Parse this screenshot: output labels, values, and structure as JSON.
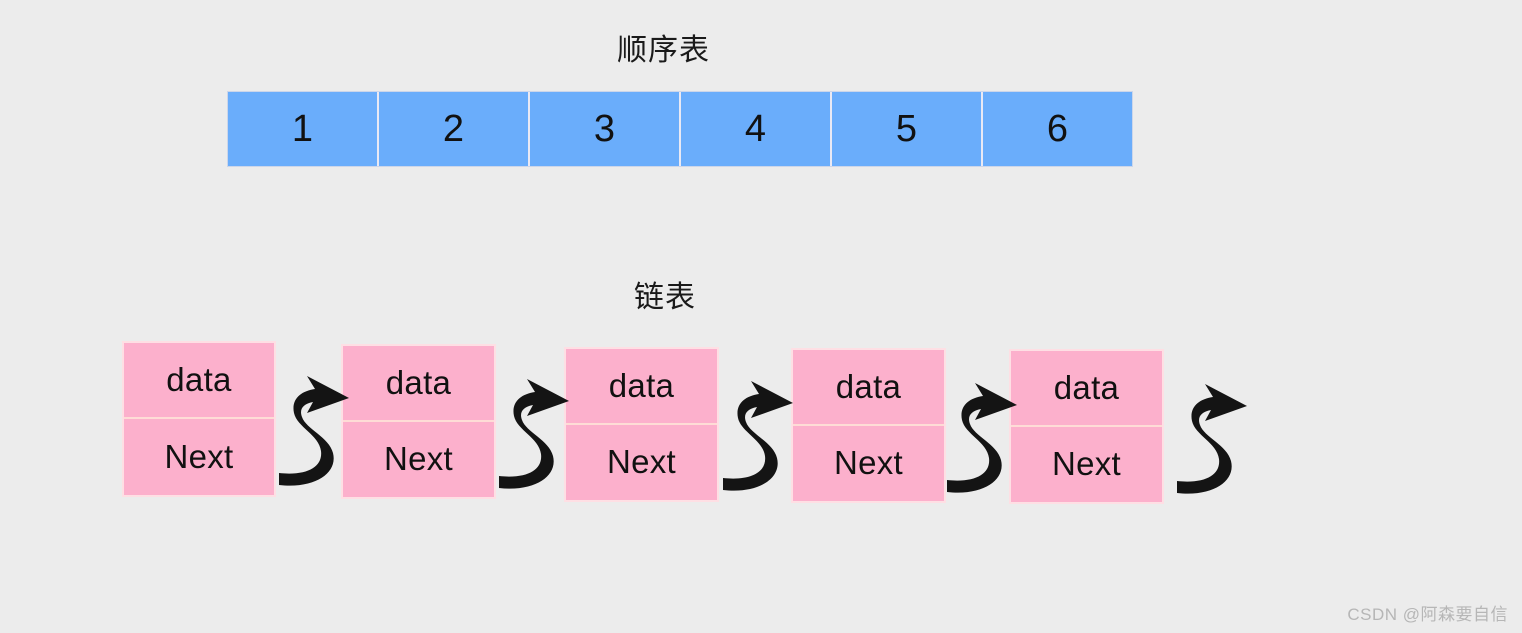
{
  "background_color": "#ececec",
  "sections": {
    "array": {
      "title": "顺序表",
      "cell_color": "#6aadfb",
      "cells": [
        "1",
        "2",
        "3",
        "4",
        "5",
        "6"
      ]
    },
    "list": {
      "title": "链表",
      "node_color": "#fcb0cc",
      "arrow_color": "#111111",
      "nodes": [
        {
          "data_label": "data",
          "next_label": "Next"
        },
        {
          "data_label": "data",
          "next_label": "Next"
        },
        {
          "data_label": "data",
          "next_label": "Next"
        },
        {
          "data_label": "data",
          "next_label": "Next"
        },
        {
          "data_label": "data",
          "next_label": "Next"
        }
      ],
      "arrow_count": 5
    }
  },
  "watermark": {
    "text": "CSDN @阿森要自信"
  }
}
